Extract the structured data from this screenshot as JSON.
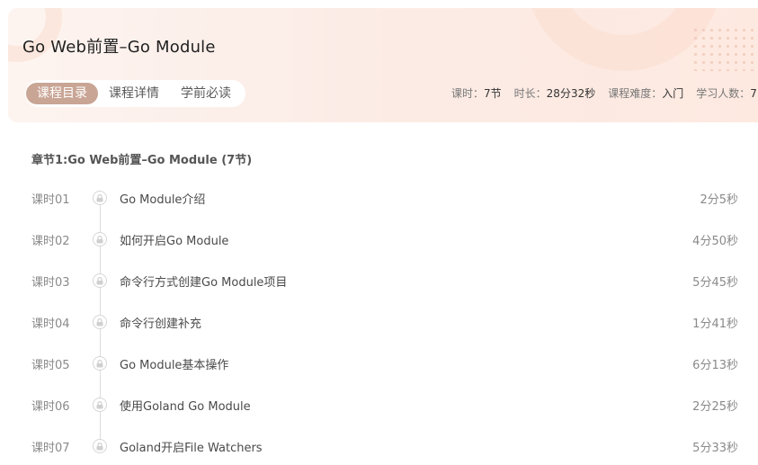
{
  "header": {
    "title": "Go Web前置–Go Module"
  },
  "tabs": [
    {
      "label": "课程目录",
      "active": true
    },
    {
      "label": "课程详情",
      "active": false
    },
    {
      "label": "学前必读",
      "active": false
    }
  ],
  "meta": {
    "lessons_label": "课时：",
    "lessons_value": "7节",
    "duration_label": "时长：",
    "duration_value": "28分32秒",
    "difficulty_label": "课程难度：",
    "difficulty_value": "入门",
    "learners_label": "学习人数：",
    "learners_value": "7"
  },
  "chapter": {
    "title": "章节1:Go Web前置–Go Module (7节)"
  },
  "lessons": [
    {
      "num": "课时01",
      "name": "Go Module介绍",
      "duration": "2分5秒"
    },
    {
      "num": "课时02",
      "name": "如何开启Go Module",
      "duration": "4分50秒"
    },
    {
      "num": "课时03",
      "name": "命令行方式创建Go Module项目",
      "duration": "5分45秒"
    },
    {
      "num": "课时04",
      "name": "命令行创建补充",
      "duration": "1分41秒"
    },
    {
      "num": "课时05",
      "name": "Go Module基本操作",
      "duration": "6分13秒"
    },
    {
      "num": "课时06",
      "name": "使用Goland Go Module",
      "duration": "2分25秒"
    },
    {
      "num": "课时07",
      "name": "Goland开启File Watchers",
      "duration": "5分33秒"
    }
  ],
  "colors": {
    "active_tab": "#c9a595",
    "header_bg": "#fcebe5"
  },
  "icons": {
    "lesson_status": "lock-icon"
  }
}
